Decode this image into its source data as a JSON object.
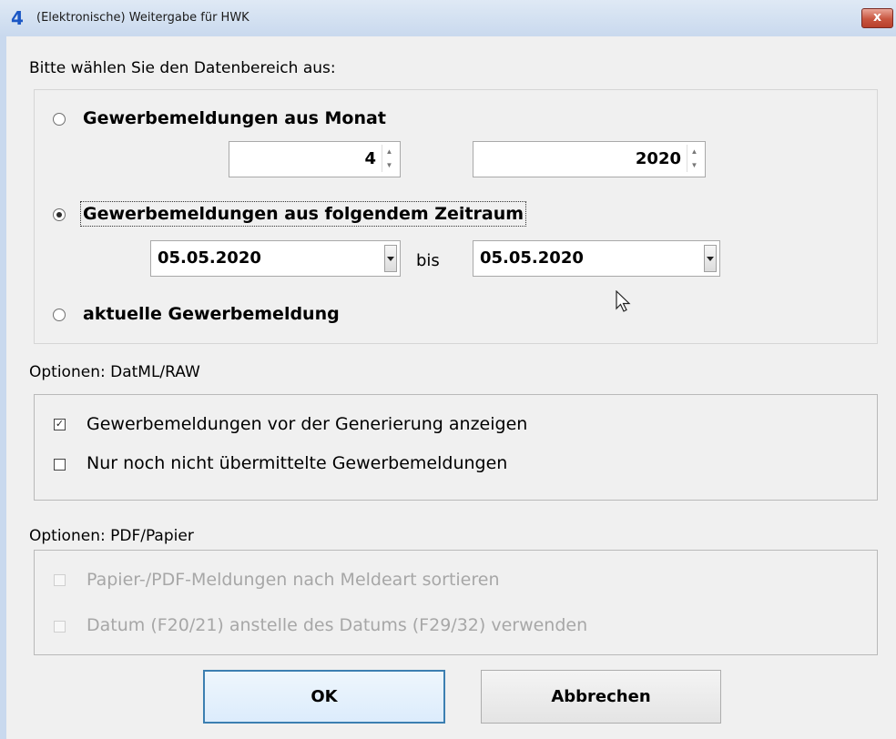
{
  "window": {
    "title": "(Elektronische) Weitergabe für HWK",
    "app_icon": "4",
    "close_label": "x"
  },
  "prompt": "Bitte wählen Sie den Datenbereich aus:",
  "range": {
    "option_month": {
      "label": "Gewerbemeldungen aus Monat",
      "selected": false
    },
    "month_value": "4",
    "year_value": "2020",
    "option_period": {
      "label": "Gewerbemeldungen aus folgendem Zeitraum",
      "selected": true
    },
    "date_from": "05.05.2020",
    "bis_label": "bis",
    "date_to": "05.05.2020",
    "option_current": {
      "label": "aktuelle Gewerbemeldung",
      "selected": false
    }
  },
  "datml": {
    "heading": "Optionen: DatML/RAW",
    "opt_show": {
      "label": "Gewerbemeldungen vor der Generierung anzeigen",
      "checked": true,
      "mark": "✓"
    },
    "opt_untransmitted": {
      "label": "Nur noch nicht übermittelte Gewerbemeldungen",
      "checked": false
    }
  },
  "pdf": {
    "heading": "Optionen: PDF/Papier",
    "opt_sort": {
      "label": "Papier-/PDF-Meldungen nach Meldeart sortieren",
      "checked": false,
      "enabled": false
    },
    "opt_date": {
      "label": "Datum (F20/21) anstelle des Datums (F29/32) verwenden",
      "checked": false,
      "enabled": false
    }
  },
  "buttons": {
    "ok": "OK",
    "cancel": "Abbrechen"
  }
}
